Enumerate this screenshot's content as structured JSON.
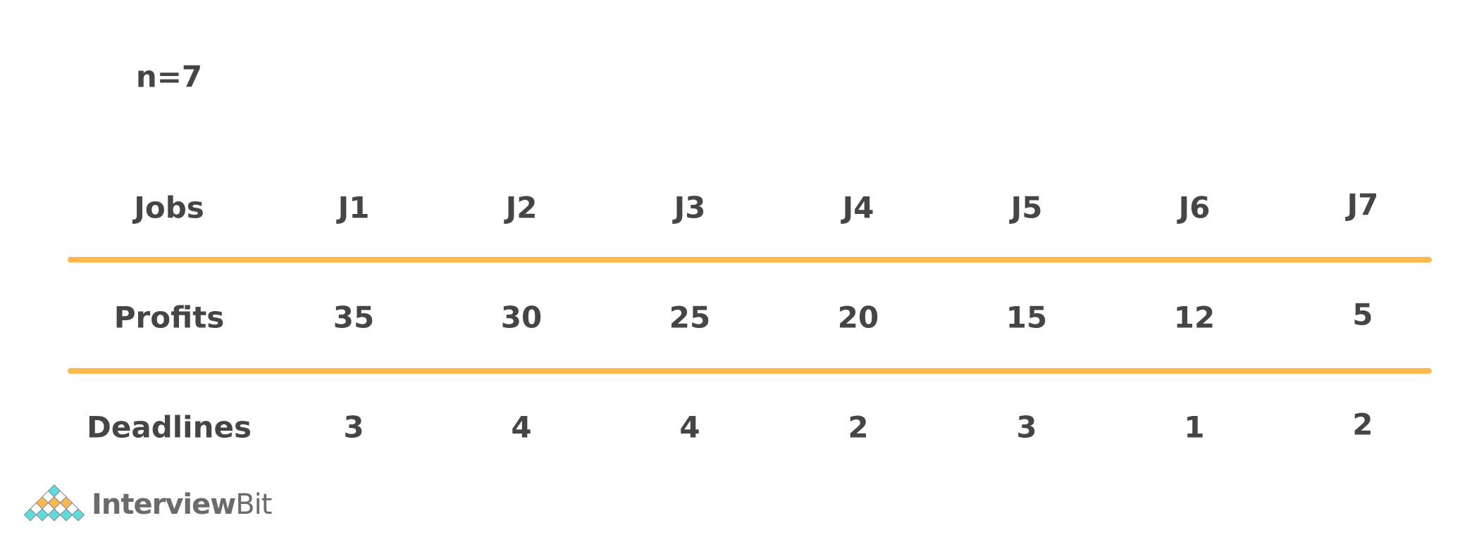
{
  "n_label": "n=7",
  "row_headers": [
    "Jobs",
    "Profits",
    "Deadlines"
  ],
  "jobs": [
    "J1",
    "J2",
    "J3",
    "J4",
    "J5",
    "J6",
    "J7"
  ],
  "profits": [
    "35",
    "30",
    "25",
    "20",
    "15",
    "12",
    "5"
  ],
  "deadlines": [
    "3",
    "4",
    "4",
    "2",
    "3",
    "1",
    "2"
  ],
  "colors": {
    "divider": "#FFB84D",
    "text": "#454545",
    "logo_cyan": "#5DDCE0",
    "logo_orange": "#FFB84D"
  },
  "logo": {
    "bold": "Interview",
    "light": "Bit"
  }
}
